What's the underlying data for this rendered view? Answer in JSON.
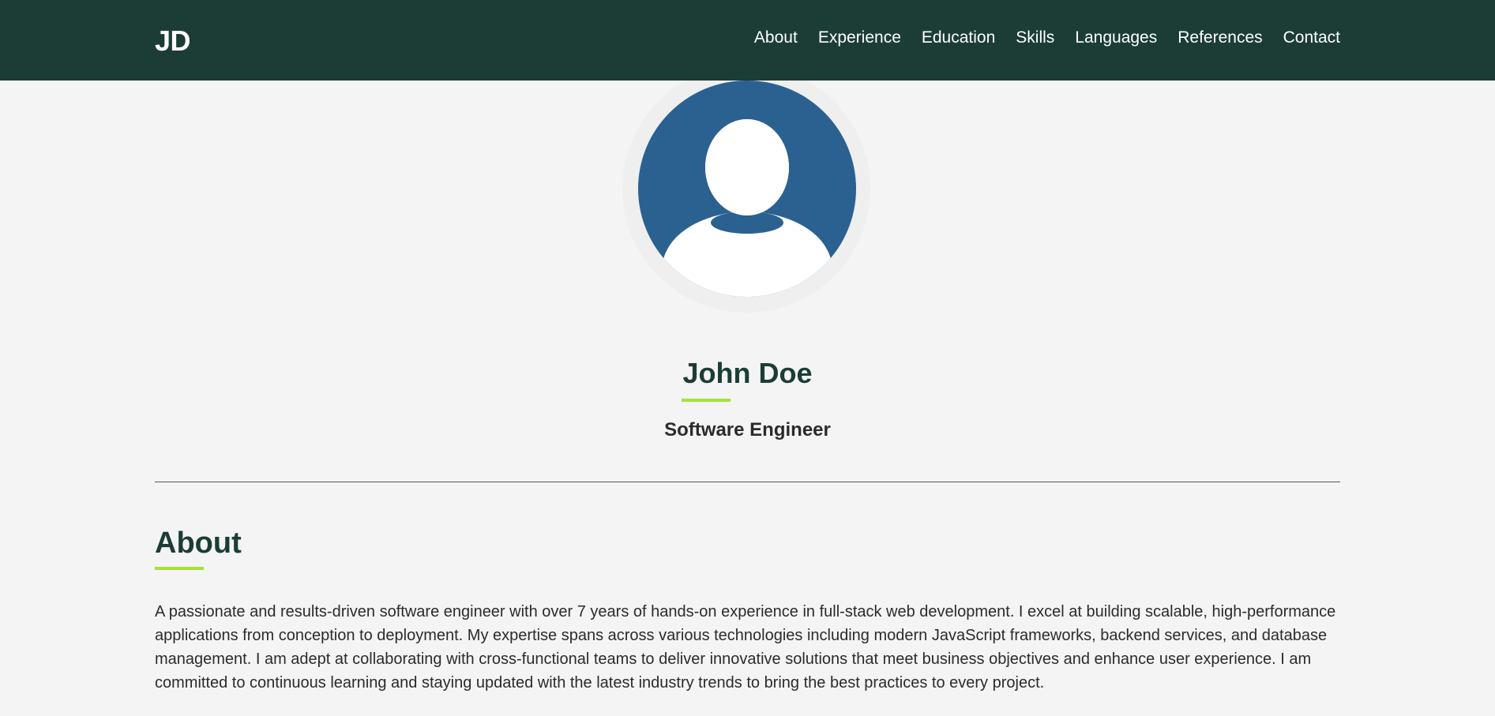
{
  "nav": {
    "brand": "JD",
    "links": [
      "About",
      "Experience",
      "Education",
      "Skills",
      "Languages",
      "References",
      "Contact"
    ]
  },
  "profile": {
    "avatar_icon": "user-silhouette-icon",
    "name": "John Doe",
    "title": "Software Engineer"
  },
  "about": {
    "heading": "About",
    "text": "A passionate and results-driven software engineer with over 7 years of hands-on experience in full-stack web development. I excel at building scalable, high-performance applications from conception to deployment. My expertise spans across various technologies including modern JavaScript frameworks, backend services, and database management. I am adept at collaborating with cross-functional teams to deliver innovative solutions that meet business objectives and enhance user experience. I am committed to continuous learning and staying updated with the latest industry trends to bring the best practices to every project."
  },
  "colors": {
    "navbar_bg": "#1b3d36",
    "accent": "#a3e23a",
    "avatar_bg": "#2a6191",
    "page_bg": "#f4f4f4"
  }
}
